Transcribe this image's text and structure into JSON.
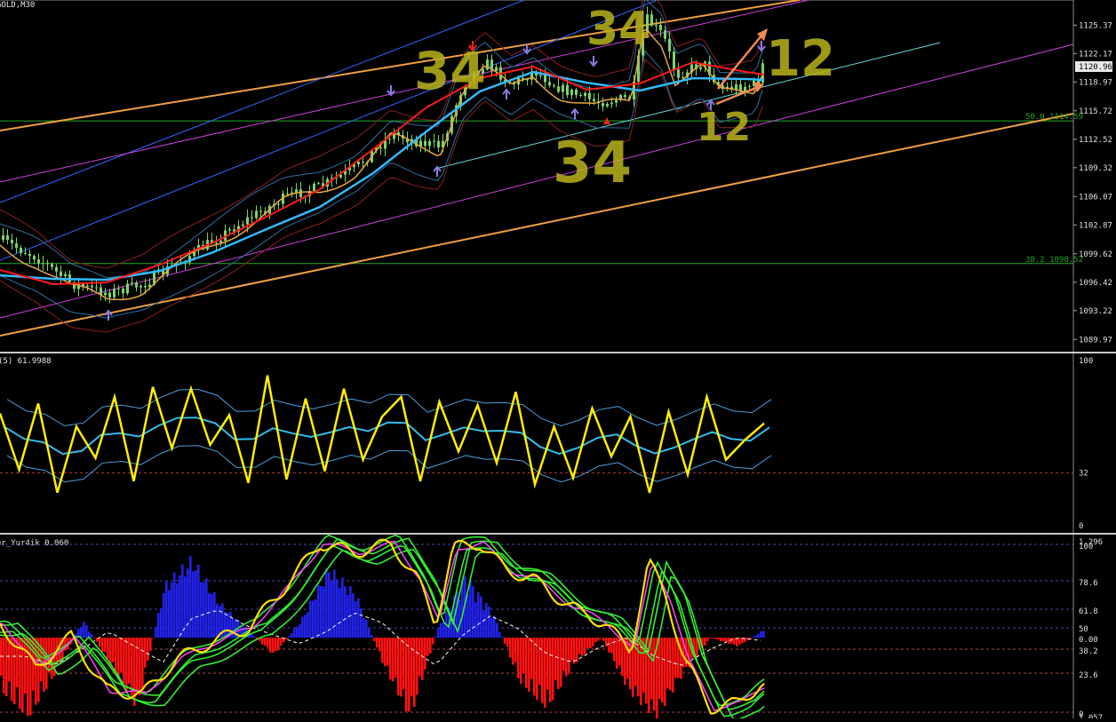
{
  "window": {
    "title": "GOLD,M30",
    "current_price": "1120.96",
    "current_price_value": 1120.96
  },
  "main_pane": {
    "price_min": 1088.5,
    "price_max": 1128.2,
    "ticks": [
      "1125.37",
      "1122.17",
      "1118.97",
      "1115.72",
      "1112.52",
      "1109.32",
      "1106.07",
      "1102.87",
      "1099.62",
      "1096.42",
      "1093.22",
      "1089.97"
    ],
    "tick_values": [
      1125.37,
      1122.17,
      1118.97,
      1115.72,
      1112.52,
      1109.32,
      1106.07,
      1102.87,
      1099.62,
      1096.42,
      1093.22,
      1089.97
    ],
    "fib_levels": [
      {
        "label": "50.0 1114.59",
        "value": 1114.59
      },
      {
        "label": "38.2 1098.52",
        "value": 1098.52
      }
    ],
    "annotations": [
      "34",
      "34",
      "34",
      "12",
      "12"
    ],
    "colors": {
      "candle": "#7cd36a",
      "ema_fast": "#ff1a1a",
      "ema_slow": "#33bbff",
      "ma_orange": "#e8a640",
      "channel_orange": "#f0a040",
      "channel_magenta": "#d040e0",
      "channel_blue": "#3366ff",
      "channel_teal": "#66dddd",
      "fib": "#22aa22",
      "annotation": "#b9b31a",
      "arrow_up": "#8a7be0",
      "arrow_down": "#8a7be0",
      "red_arrow": "#ff2020",
      "orange_arrow": "#f08a50"
    }
  },
  "rsi_pane": {
    "title": "(5) 61.9988",
    "ticks": [
      "100",
      "32",
      "0"
    ],
    "tick_values": [
      100,
      32,
      0
    ],
    "colors": {
      "main": "#ffee00",
      "signal": "#33bbee",
      "bands": "#4aa0e0",
      "level": "#aa3333"
    }
  },
  "osc_pane": {
    "title": "er_Yur4ik 0.060",
    "ticks": [
      "1.296",
      "100",
      "78.6",
      "61.8",
      "50",
      "0.00",
      "38.2",
      "23.6",
      "1.057",
      "0"
    ],
    "colors": {
      "pos_hist": "#2222ee",
      "neg_hist": "#ff1111",
      "lines_green": "#33ee33",
      "line_yellow": "#ffdd00",
      "line_magenta": "#ff44ff",
      "baseline": "#ffffff"
    }
  },
  "chart_data": [
    {
      "type": "line",
      "title": "GOLD,M30",
      "ylim": [
        1088.5,
        1128.2
      ],
      "series": [
        {
          "name": "EMA",
          "x": [
            0,
            60,
            120,
            180,
            240,
            300,
            360,
            420,
            480,
            540,
            600,
            660,
            720,
            780,
            840,
            860
          ],
          "values": [
            1097.8,
            1096.2,
            1096.4,
            1098.4,
            1100.9,
            1103.8,
            1106.9,
            1111.4,
            1116.1,
            1119.4,
            1120.7,
            1118.1,
            1118.8,
            1121.2,
            1120.1,
            1119.8
          ]
        },
        {
          "name": "EMA2",
          "x": [
            0,
            60,
            120,
            180,
            240,
            300,
            360,
            420,
            480,
            540,
            600,
            660,
            720,
            780,
            840,
            860
          ],
          "values": [
            1097.2,
            1096.8,
            1096.7,
            1097.7,
            1099.8,
            1102.4,
            1104.9,
            1108.7,
            1113.4,
            1117.9,
            1120.1,
            1118.9,
            1118.0,
            1119.4,
            1119.3,
            1119.2
          ]
        }
      ]
    },
    {
      "type": "line",
      "title": "(5) 61.9988",
      "ylim": [
        0,
        100
      ],
      "series": [
        {
          "name": "RSI",
          "values": [
            68,
            34,
            74,
            20,
            60,
            41,
            78,
            27,
            84,
            47,
            83,
            49,
            67,
            26,
            91,
            28,
            77,
            33,
            83,
            40,
            66,
            78,
            27,
            75,
            45,
            73,
            38,
            81,
            25,
            60,
            29,
            71,
            42,
            66,
            20,
            69,
            31,
            78,
            40,
            52,
            62
          ]
        }
      ]
    },
    {
      "type": "bar",
      "title": "er_Yur4ik 0.060",
      "ylim": [
        -1.057,
        1.296
      ],
      "series": [
        {
          "name": "Histogram",
          "values": [
            -0.6,
            -0.9,
            -0.4,
            0.2,
            -0.3,
            -0.8,
            0.6,
            0.9,
            0.4,
            0.1,
            -0.2,
            0.2,
            0.8,
            0.5,
            -0.3,
            -0.9,
            0.1,
            0.7,
            0.3,
            -0.5,
            -0.8,
            -0.3,
            0.0,
            -0.6,
            -0.9,
            -0.4,
            0.0,
            -0.1,
            0.1
          ]
        }
      ]
    }
  ]
}
